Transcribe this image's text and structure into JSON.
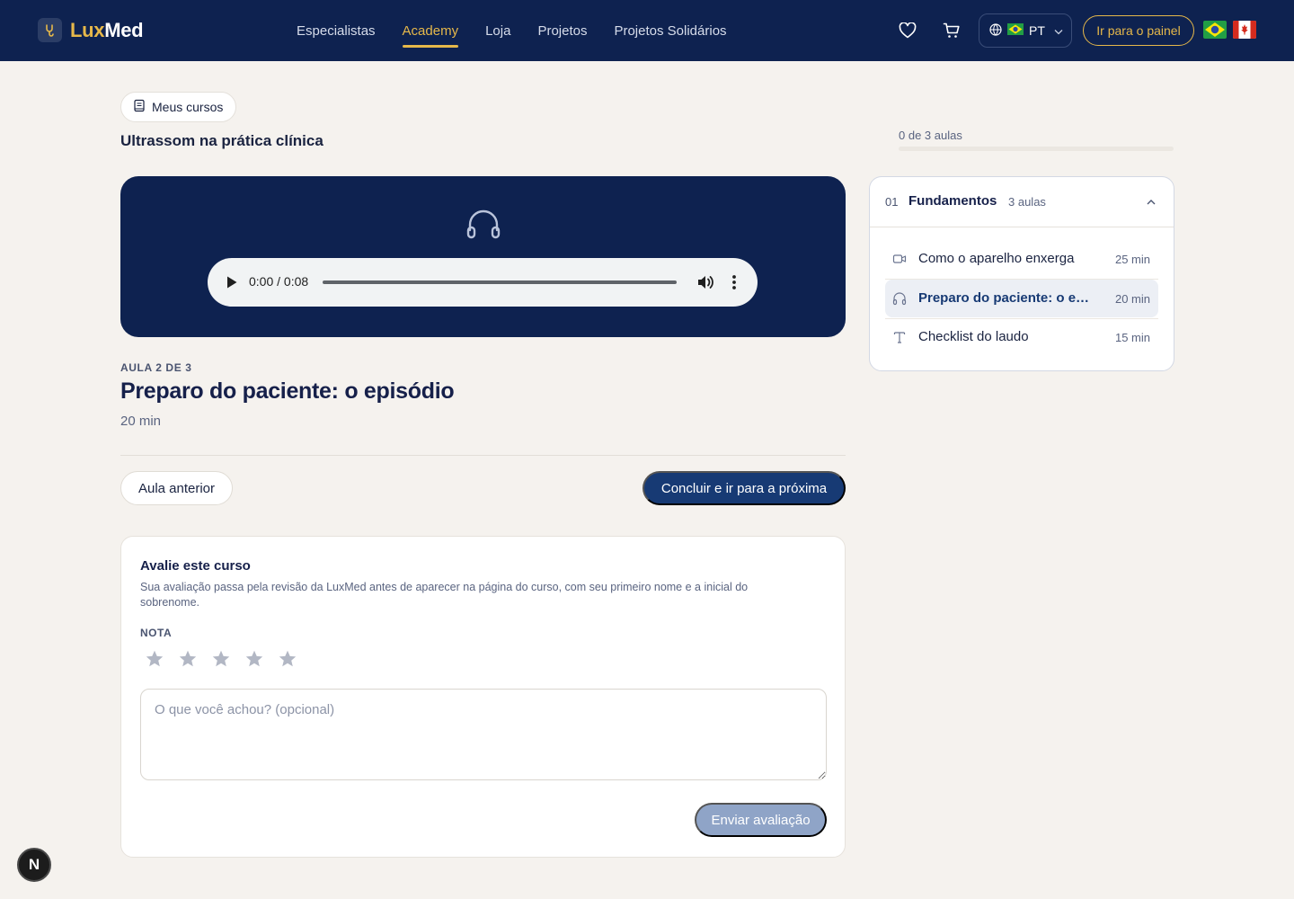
{
  "header": {
    "brand_lux": "Lux",
    "brand_med": "Med",
    "nav": [
      {
        "label": "Especialistas",
        "active": false
      },
      {
        "label": "Academy",
        "active": true
      },
      {
        "label": "Loja",
        "active": false
      },
      {
        "label": "Projetos",
        "active": false
      },
      {
        "label": "Projetos Solidários",
        "active": false
      }
    ],
    "language_code": "PT",
    "panel_button": "Ir para o painel",
    "icons": [
      "heart-icon",
      "cart-icon",
      "globe-icon",
      "chevron-down-icon"
    ],
    "flags": [
      "flag-brazil",
      "flag-canada"
    ]
  },
  "course": {
    "back_label": "Meus cursos",
    "title": "Ultrassom na prática clínica"
  },
  "player": {
    "time": "0:00 / 0:08",
    "icon": "headphones-icon"
  },
  "lesson": {
    "kicker": "AULA 2 DE 3",
    "title": "Preparo do paciente: o episódio",
    "duration": "20 min",
    "prev_label": "Aula anterior",
    "next_label": "Concluir e ir para a próxima"
  },
  "review": {
    "title": "Avalie este curso",
    "description": "Sua avaliação passa pela revisão da LuxMed antes de aparecer na página do curso, com seu primeiro nome e a inicial do sobrenome.",
    "rating_label": "NOTA",
    "rating_value": 0,
    "rating_max": 5,
    "placeholder": "O que você achou? (opcional)",
    "submit_label": "Enviar avaliação"
  },
  "progress": {
    "text": "0 de 3 aulas",
    "fraction": 0
  },
  "module": {
    "number": "01",
    "name": "Fundamentos",
    "count": "3 aulas",
    "lessons": [
      {
        "name": "Como o aparelho enxerga",
        "duration": "25 min",
        "icon": "video-icon",
        "active": false
      },
      {
        "name": "Preparo do paciente: o episódio",
        "duration": "20 min",
        "icon": "headphones-icon",
        "active": true
      },
      {
        "name": "Checklist do laudo",
        "duration": "15 min",
        "icon": "text-icon",
        "active": false
      }
    ]
  },
  "colors": {
    "navy": "#0e2250",
    "gold": "#e6b84a",
    "primary_button": "#173a74",
    "background": "#f5f2ee"
  },
  "badge": "N"
}
